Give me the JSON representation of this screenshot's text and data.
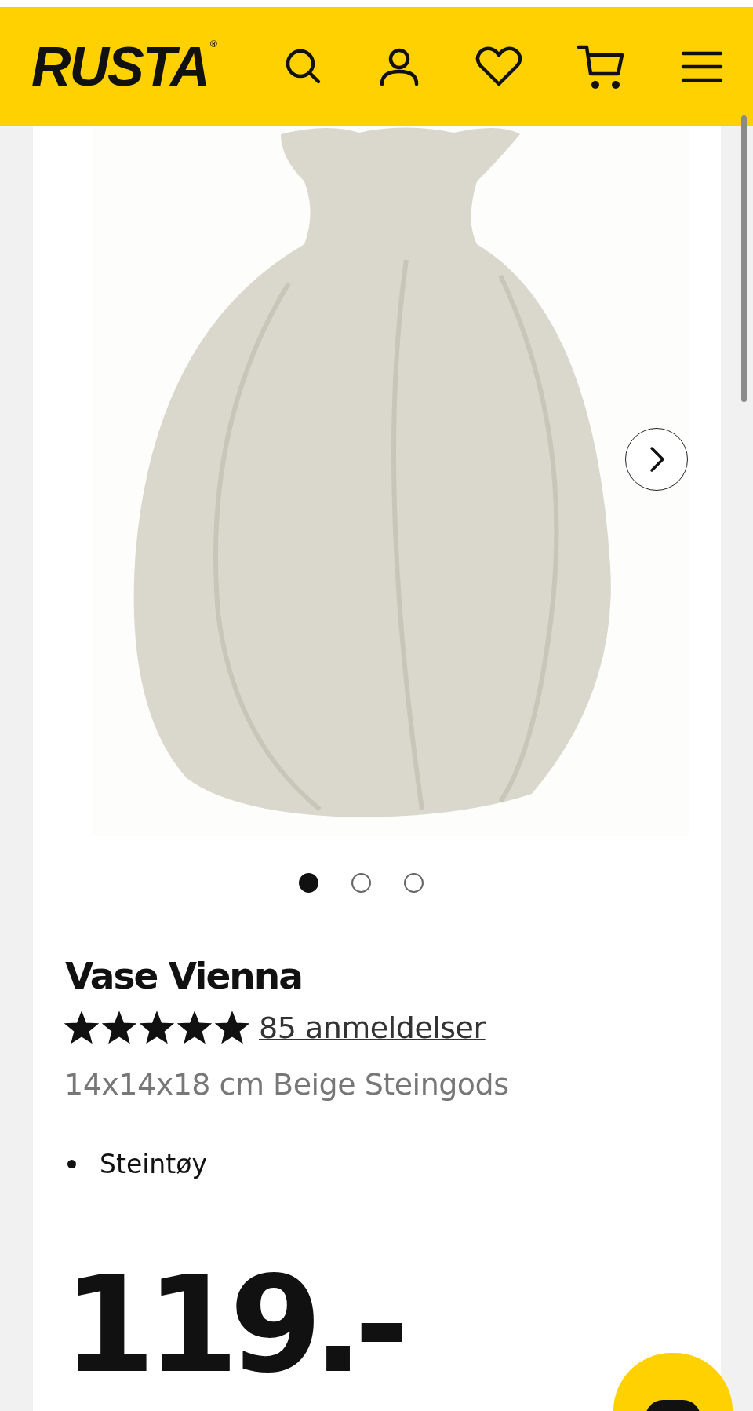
{
  "header": {
    "logo": "RUSTA",
    "logo_mark": "®"
  },
  "gallery": {
    "dots": [
      {
        "selected": true
      },
      {
        "selected": false
      },
      {
        "selected": false
      }
    ]
  },
  "product": {
    "title": "Vase Vienna",
    "stars": 5,
    "reviews_link": "85 anmeldelser",
    "description": "14x14x18 cm Beige Steingods",
    "features": [
      "Steintøy"
    ],
    "price": "119.-"
  }
}
